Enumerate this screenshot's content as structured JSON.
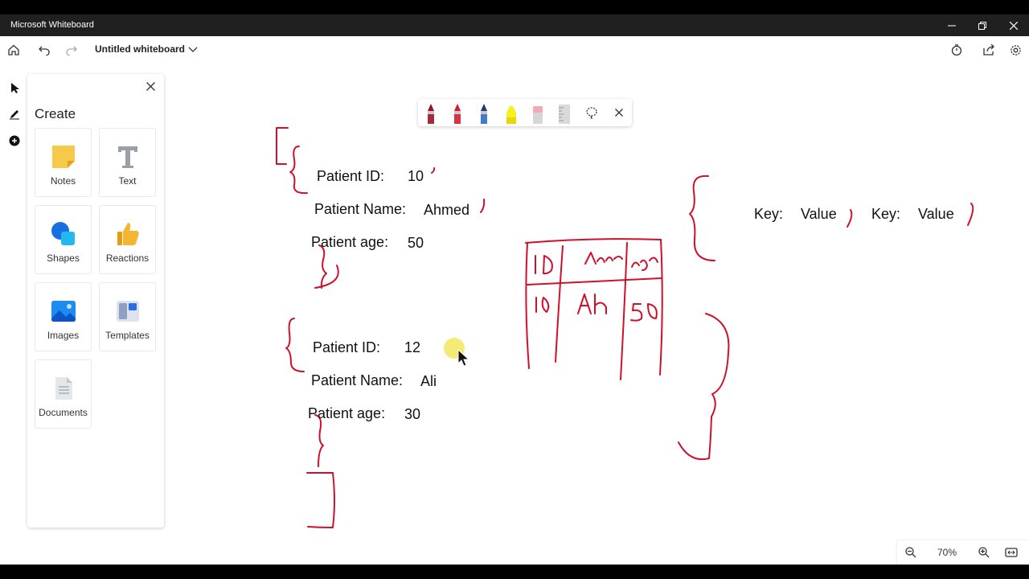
{
  "app": {
    "title": "Microsoft Whiteboard"
  },
  "toolbar": {
    "doc_title": "Untitled whiteboard"
  },
  "panel": {
    "heading": "Create",
    "tiles": [
      {
        "label": "Notes",
        "icon": "sticky-note-icon"
      },
      {
        "label": "Text",
        "icon": "text-icon"
      },
      {
        "label": "Shapes",
        "icon": "shapes-icon"
      },
      {
        "label": "Reactions",
        "icon": "thumbs-up-icon"
      },
      {
        "label": "Images",
        "icon": "image-icon"
      },
      {
        "label": "Templates",
        "icon": "templates-icon"
      },
      {
        "label": "Documents",
        "icon": "document-icon"
      }
    ]
  },
  "pen_tray": {
    "tools": [
      "pen-dark-red",
      "pen-red",
      "pen-blue",
      "highlighter-yellow",
      "eraser",
      "ruler",
      "lasso",
      "close"
    ]
  },
  "board": {
    "record1": {
      "id_label": "Patient ID:",
      "id_value": "10",
      "name_label": "Patient Name:",
      "name_value": "Ahmed",
      "age_label": "Patient age:",
      "age_value": "50"
    },
    "record2": {
      "id_label": "Patient ID:",
      "id_value": "12",
      "name_label": "Patient Name:",
      "name_value": "Ali",
      "age_label": "Patient age:",
      "age_value": "30"
    },
    "kv": {
      "key1": "Key:",
      "value1": "Value",
      "key2": "Key:",
      "value2": "Value"
    }
  },
  "zoom": {
    "level": "70%"
  },
  "colors": {
    "ink": "#d0102a",
    "titlebar": "#202020"
  }
}
